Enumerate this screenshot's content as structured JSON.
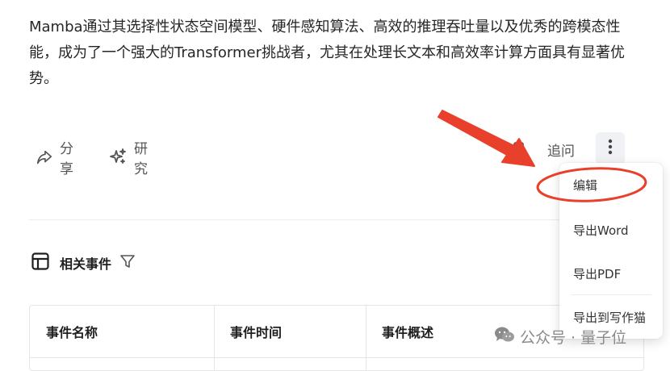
{
  "answer": {
    "paragraph": "Mamba通过其选择性状态空间模型、硬件感知算法、高效的推理吞吐量以及优秀的跨模态性能，成为了一个强大的Transformer挑战者，尤其在处理长文本和高效率计算方面具有显著优势。"
  },
  "actions": {
    "share_label": "分享",
    "research_label": "研究",
    "followup_label": "追问"
  },
  "more_menu": {
    "items": [
      "编辑",
      "导出Word",
      "导出PDF",
      "导出到写作猫"
    ],
    "highlighted": "编辑",
    "annotation_color": "#e8402a"
  },
  "related_events": {
    "title": "相关事件",
    "columns": [
      "事件名称",
      "事件时间",
      "事件概述"
    ]
  },
  "watermark": {
    "text": "公众号 · 量子位"
  }
}
